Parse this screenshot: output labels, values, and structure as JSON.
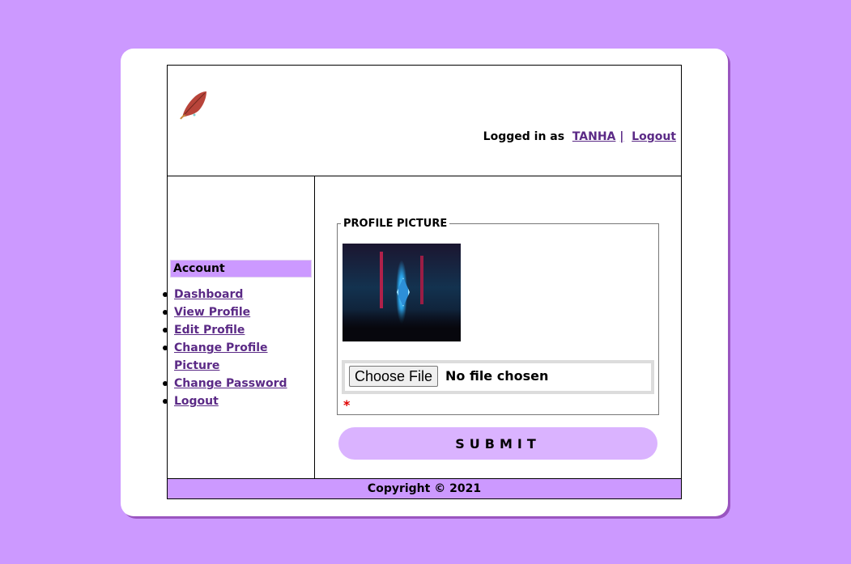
{
  "header": {
    "logo_icon": "leaf-icon",
    "logged_in_prefix": "Logged in as",
    "username": "TANHA",
    "separator": "|",
    "logout_label": "Logout"
  },
  "sidebar": {
    "title": "Account",
    "items": [
      {
        "label": "Dashboard"
      },
      {
        "label": "View Profile"
      },
      {
        "label": "Edit Profile"
      },
      {
        "label": "Change Profile Picture"
      },
      {
        "label": "Change Password"
      },
      {
        "label": "Logout"
      }
    ]
  },
  "form": {
    "legend": "PROFILE PICTURE",
    "choose_file_label": "Choose File",
    "file_status": "No file chosen",
    "required_marker": "*",
    "submit_label": "SUBMIT"
  },
  "footer": {
    "copyright": "Copyright © 2021"
  },
  "colors": {
    "page_background": "#cc99ff",
    "accent": "#cc99ff",
    "submit_background": "#dab3ff",
    "link": "#5b2a86",
    "required": "#e00000"
  }
}
